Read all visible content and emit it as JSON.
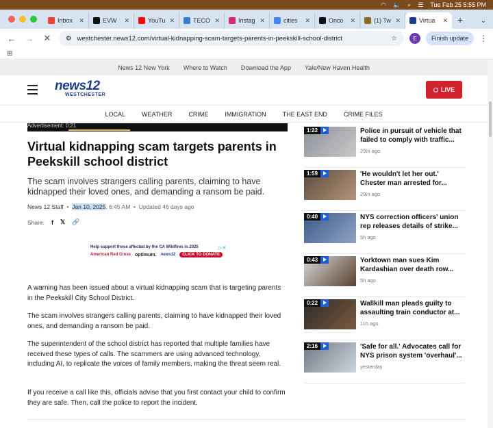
{
  "os_menubar": {
    "date_time": "Tue Feb 25  5:55 PM"
  },
  "browser": {
    "tabs": [
      {
        "label": "Inbox",
        "icon": "gmail-icon",
        "color": "#ea4335"
      },
      {
        "label": "EVW",
        "icon": "x-icon",
        "color": "#111111"
      },
      {
        "label": "YouTu",
        "icon": "youtube-icon",
        "color": "#ff0000"
      },
      {
        "label": "TECO",
        "icon": "page-icon",
        "color": "#3a7bd5"
      },
      {
        "label": "Instag",
        "icon": "instagram-icon",
        "color": "#d62976"
      },
      {
        "label": "cities",
        "icon": "google-icon",
        "color": "#4285f4"
      },
      {
        "label": "Onco",
        "icon": "x-icon",
        "color": "#111111"
      },
      {
        "label": "(1) Tw",
        "icon": "page-icon",
        "color": "#8a6d1e"
      },
      {
        "label": "Virtua",
        "icon": "globe-icon",
        "color": "#1b3d8c"
      }
    ],
    "url": "westchester.news12.com/virtual-kidnapping-scam-targets-parents-in-peekskill-school-district",
    "profile_initial": "E",
    "finish_update": "Finish update"
  },
  "site": {
    "top_links": [
      "News 12 New York",
      "Where to Watch",
      "Download the App",
      "Yale/New Haven Health"
    ],
    "logo_main": "news12",
    "logo_sub": "WESTCHESTER",
    "live_label": "LIVE",
    "nav": [
      "LOCAL",
      "WEATHER",
      "CRIME",
      "IMMIGRATION",
      "THE EAST END",
      "CRIME FILES"
    ]
  },
  "article": {
    "video_caption": "Advertisement: 0:21",
    "headline": "Virtual kidnapping scam targets parents in Peekskill school district",
    "dek": "The scam involves strangers calling parents, claiming to have kidnapped their loved ones, and demanding a ransom be paid.",
    "author": "News 12 Staff",
    "date": "Jan 10, 2025",
    "time": ", 6:45 AM",
    "updated": "Updated 46 days ago",
    "share_label": "Share:",
    "ad": {
      "headline": "Help support those affected by the CA Wildfires in 2025",
      "red_cross": "American Red Cross",
      "optimum": "optimum.",
      "news12": "news12",
      "cta": "CLICK TO DONATE"
    },
    "paragraphs": [
      "A warning has been issued about a virtual kidnapping scam that is targeting parents in the Peekskill City School District.",
      "The scam involves strangers calling parents, claiming to have kidnapped their loved ones, and demanding a ransom be paid.",
      "The superintendent of the school district has reported that multiple families have received these types of calls. The scammers are using advanced technology, including AI, to replicate the voices of family members, making the threat seem real.",
      "If you receive a call like this, officials advise that you first contact your child to confirm they are safe. Then, call the police to report the incident."
    ]
  },
  "sidebar": [
    {
      "duration": "1:22",
      "title": "Police in pursuit of vehicle that failed to comply with traffic...",
      "ago": "29m ago"
    },
    {
      "duration": "1:59",
      "title": "'He wouldn't let her out.' Chester man arrested for...",
      "ago": "29m ago"
    },
    {
      "duration": "0:40",
      "title": "NYS correction officers' union rep releases details of strike...",
      "ago": "5h ago"
    },
    {
      "duration": "0:43",
      "title": "Yorktown man sues Kim Kardashian over death row...",
      "ago": "5h ago"
    },
    {
      "duration": "0:22",
      "title": "Wallkill man pleads guilty to assaulting train conductor at...",
      "ago": "11h ago"
    },
    {
      "duration": "2:16",
      "title": "'Safe for all.' Advocates call for NYS prison system 'overhaul'...",
      "ago": "yesterday"
    }
  ]
}
